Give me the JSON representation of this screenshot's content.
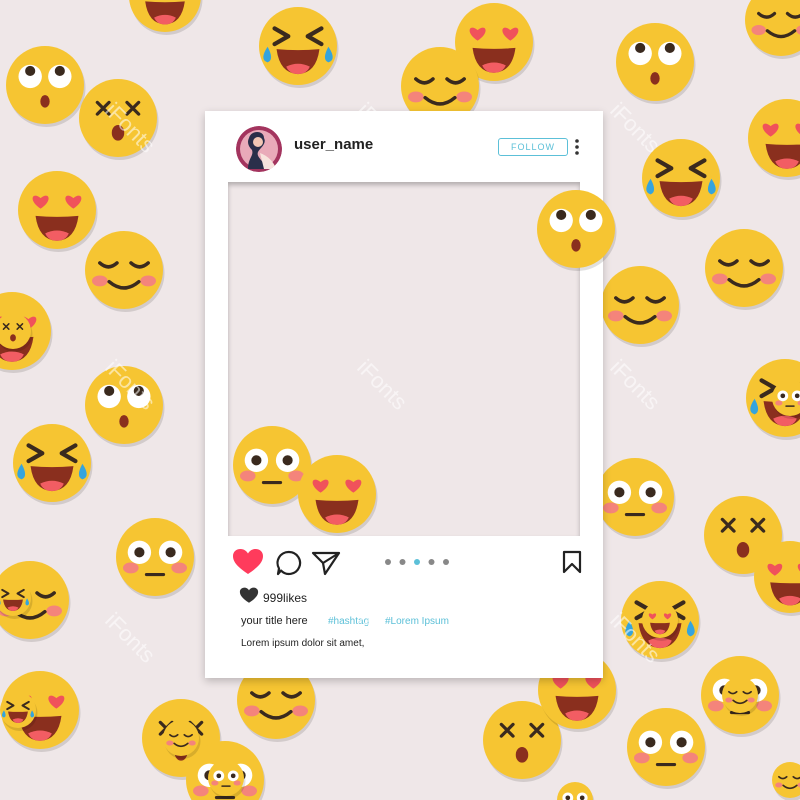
{
  "post": {
    "username": "user_name",
    "follow_label": "FOLLOW",
    "likes": "999likes",
    "title": "your title here",
    "hashtags": [
      "#hashtag",
      "#Lorem Ipsum"
    ],
    "caption": "Lorem ipsum dolor sit amet,"
  },
  "carousel": {
    "count": 5,
    "active_index": 2
  },
  "watermark": "iFonts",
  "colors": {
    "background": "#efe7e8",
    "accent": "#5cc0d8",
    "like": "#ff3b5c",
    "emoji_face": "#f6c532",
    "emoji_cheek": "#f47c83"
  },
  "emojis": [
    "heart-eyes",
    "grinning-squint-tears",
    "heart-eyes",
    "surprised-rolling-eyes",
    "relieved-smile",
    "smiling-blush",
    "rolling-eyes-surprised",
    "dizzy-face",
    "grinning-squint-tears",
    "heart-eyes",
    "relieved-smile",
    "heart-eyes",
    "heart-eyes",
    "smiling-blush",
    "grinning-squint-tears",
    "dizzy-face",
    "rolling-eyes-surprised",
    "flushed",
    "heart-eyes",
    "relieved-smile",
    "relieved-smile",
    "flushed",
    "grinning-squint-tears",
    "dizzy-face",
    "flushed",
    "flushed",
    "heart-eyes",
    "dizzy-face",
    "flushed",
    "heart-eyes",
    "smiling-blush",
    "grinning-squint-tears",
    "grinning-squint-tears",
    "grinning-squint-tears",
    "heart-eyes",
    "relieved-smile",
    "smiling-blush",
    "flushed",
    "flushed",
    "dizzy-face",
    "flushed",
    "smiling-blush"
  ]
}
